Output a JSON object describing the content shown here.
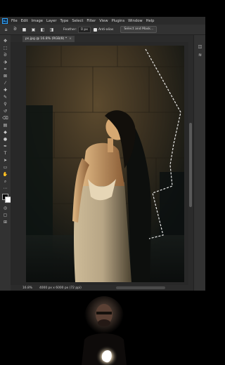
{
  "menubar": {
    "app_icon_label": "Ps",
    "items": [
      "File",
      "Edit",
      "Image",
      "Layer",
      "Type",
      "Select",
      "Filter",
      "View",
      "Plugins",
      "Window",
      "Help"
    ]
  },
  "options": {
    "feather_label": "Feather:",
    "feather_value": "0 px",
    "antialias_label": "Anti-alias",
    "select_mask_label": "Select and Mask..."
  },
  "document": {
    "tab_title": "ps.jpg @ 16.8% (RGB/8) *",
    "close_glyph": "×"
  },
  "status": {
    "zoom": "16.8%",
    "dimensions": "4000 px x 6000 px (72 ppi)"
  },
  "colors": {
    "accent": "#31a8ff",
    "panel": "#323232",
    "workspace": "#282828"
  }
}
